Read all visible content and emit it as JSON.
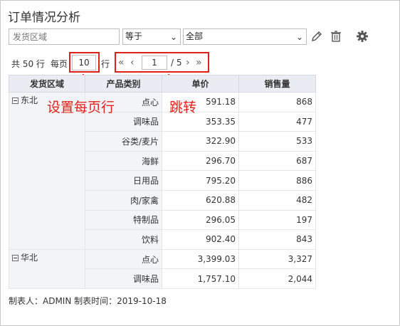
{
  "title": "订单情况分析",
  "filter": {
    "field_placeholder": "发货区域",
    "operator": "等于",
    "value": "全部",
    "edit_icon": "pencil-icon",
    "delete_icon": "trash-icon",
    "settings_icon": "gear-icon"
  },
  "pager": {
    "total_text": "共 50 行",
    "per_page_label": "每页",
    "page_size": "10",
    "rows_unit": "行",
    "first": "«",
    "prev": "‹",
    "current_page": "1",
    "total_pages_text": "/ 5",
    "next": "›",
    "last": "»"
  },
  "annotations": {
    "set_page_size": "设置每页行",
    "jump": "跳转",
    "color": "#e0211a"
  },
  "table": {
    "headers": [
      "发货区域",
      "产品类别",
      "单价",
      "销售量"
    ],
    "groups": [
      {
        "region": "东北",
        "rows": [
          {
            "category": "点心",
            "price": "591.18",
            "qty": "868"
          },
          {
            "category": "调味品",
            "price": "353.35",
            "qty": "477"
          },
          {
            "category": "谷类/麦片",
            "price": "322.90",
            "qty": "533"
          },
          {
            "category": "海鲜",
            "price": "296.70",
            "qty": "687"
          },
          {
            "category": "日用品",
            "price": "795.20",
            "qty": "886"
          },
          {
            "category": "肉/家禽",
            "price": "620.88",
            "qty": "482"
          },
          {
            "category": "特制品",
            "price": "296.05",
            "qty": "197"
          },
          {
            "category": "饮料",
            "price": "902.40",
            "qty": "843"
          }
        ]
      },
      {
        "region": "华北",
        "rows": [
          {
            "category": "点心",
            "price": "3,399.03",
            "qty": "3,327"
          },
          {
            "category": "调味品",
            "price": "1,757.10",
            "qty": "2,044"
          }
        ]
      }
    ]
  },
  "footer": "制表人：ADMIN  制表时间：2019-10-18"
}
